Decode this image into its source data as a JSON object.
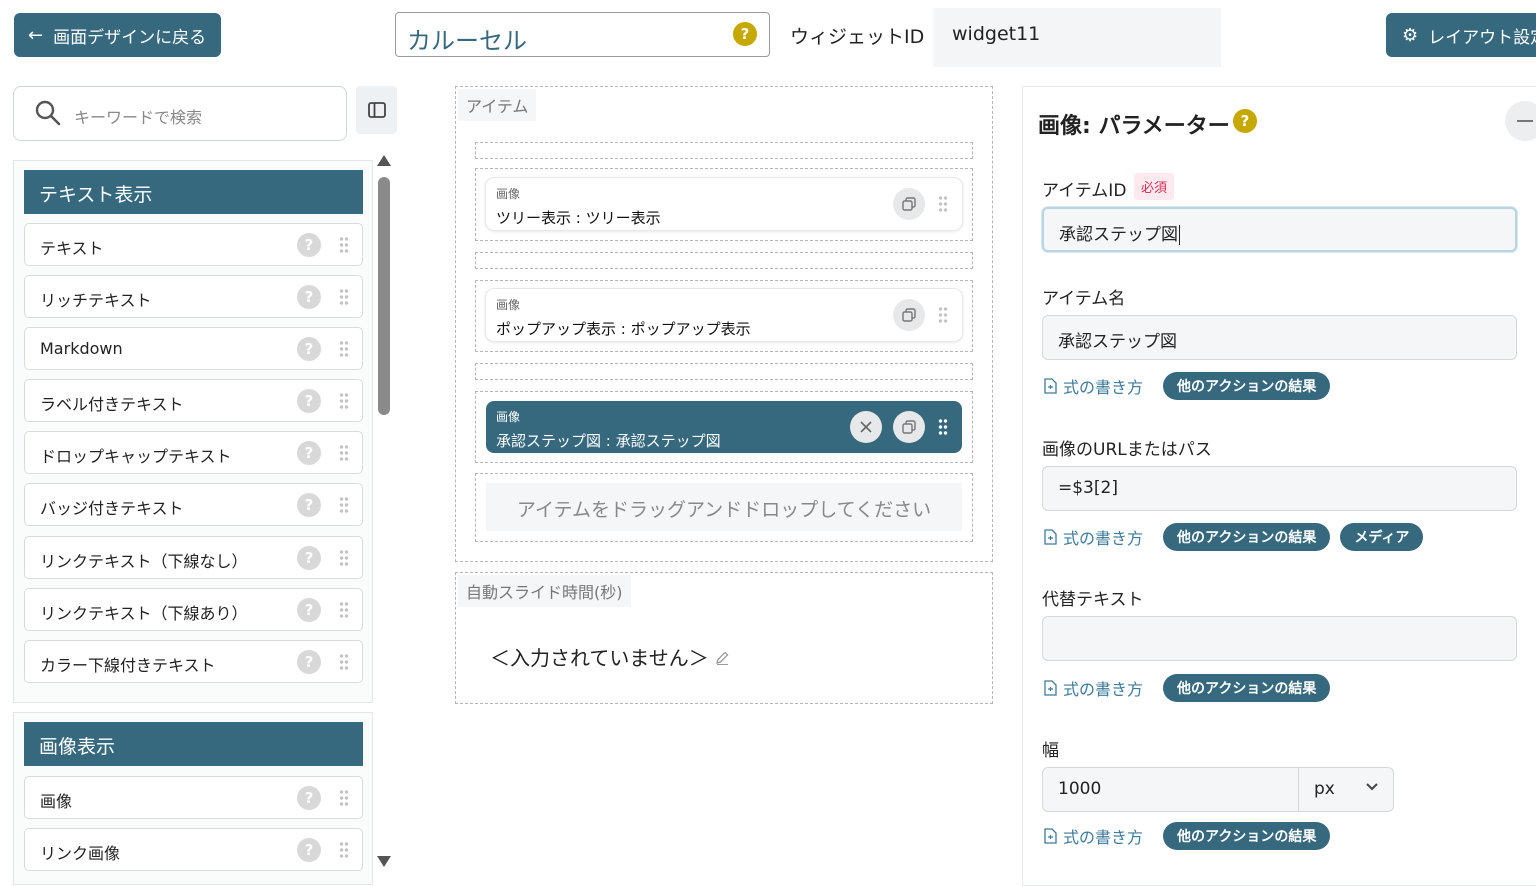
{
  "topbar": {
    "back_label": "画面デザインに戻る",
    "widget_title": "カルーセル",
    "widget_id_label": "ウィジェットID",
    "widget_id_value": "widget11",
    "layout_label": "レイアウト設定"
  },
  "left": {
    "search_placeholder": "キーワードで検索",
    "text_category": "テキスト表示",
    "text_items": [
      "テキスト",
      "リッチテキスト",
      "Markdown",
      "ラベル付きテキスト",
      "ドロップキャップテキスト",
      "バッジ付きテキスト",
      "リンクテキスト（下線なし）",
      "リンクテキスト（下線あり）",
      "カラー下線付きテキスト"
    ],
    "image_category": "画像表示",
    "image_items": [
      "画像",
      "リンク画像"
    ]
  },
  "middle": {
    "items_label": "アイテム",
    "cards": [
      {
        "type": "画像",
        "name": "ツリー表示 : ツリー表示"
      },
      {
        "type": "画像",
        "name": "ポップアップ表示 : ポップアップ表示"
      },
      {
        "type": "画像",
        "name": "承認ステップ図 : 承認ステップ図"
      }
    ],
    "drop_hint": "アイテムをドラッグアンドドロップしてください",
    "autoslide_label": "自動スライド時間(秒)",
    "autoslide_value": "＜入力されていません＞"
  },
  "right": {
    "title": "画像: パラメーター",
    "item_id_label": "アイテムID",
    "required_badge": "必須",
    "item_id_value": "承認ステップ図",
    "item_name_label": "アイテム名",
    "item_name_value": "承認ステップ図",
    "formula_link": "式の書き方",
    "other_action_result": "他のアクションの結果",
    "media": "メディア",
    "url_label": "画像のURLまたはパス",
    "url_value": "=$3[2]",
    "alt_label": "代替テキスト",
    "alt_value": "",
    "width_label": "幅",
    "width_value": "1000",
    "width_unit": "px"
  },
  "colors": {
    "primary": "#36687e",
    "help_yellow": "#c5a800",
    "required_red": "#d6335c"
  }
}
